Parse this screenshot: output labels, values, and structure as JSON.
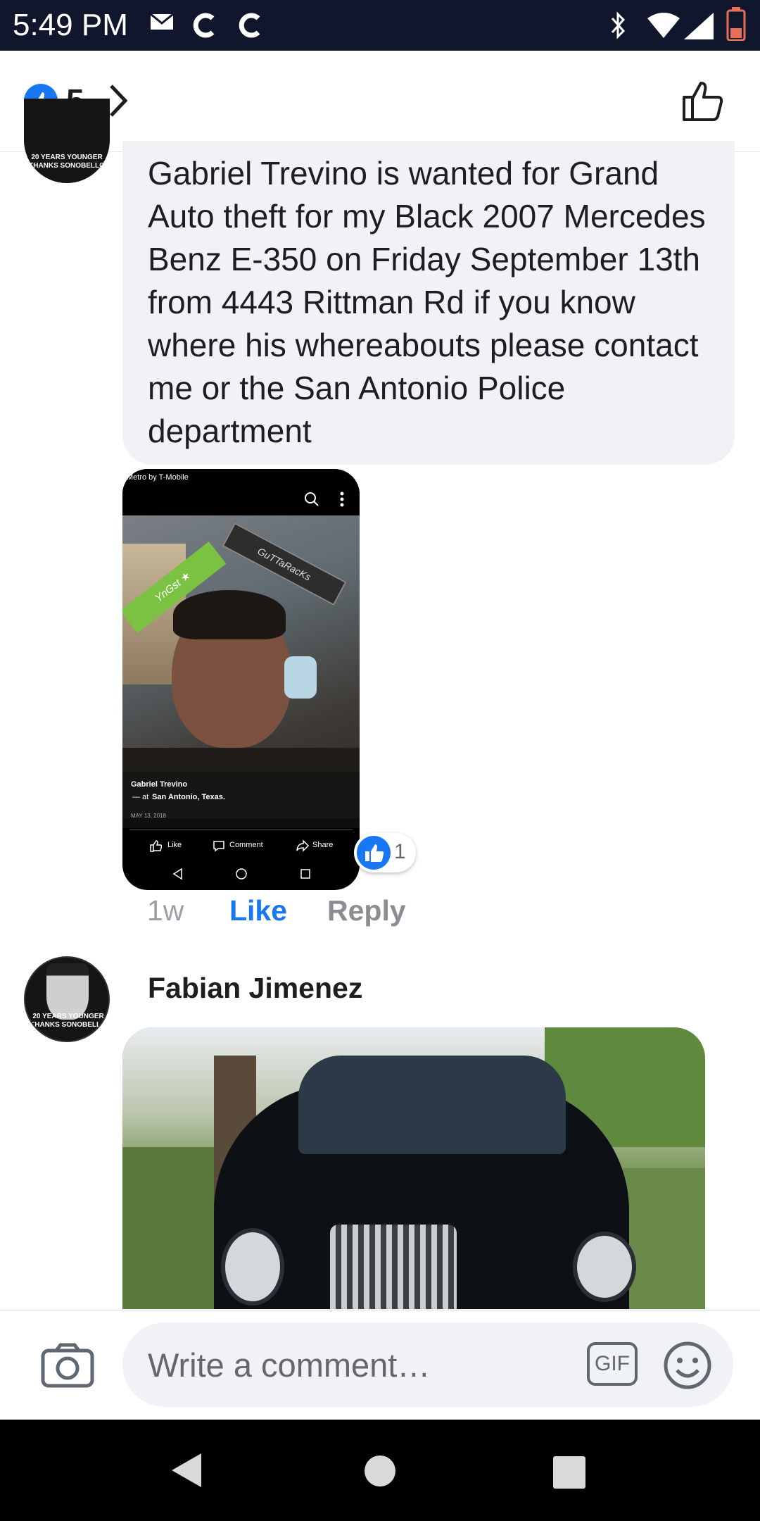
{
  "status_bar": {
    "time": "5:49 PM"
  },
  "reactions": {
    "count": "5"
  },
  "comments": [
    {
      "text": "Gabriel Trevino is wanted for Grand Auto theft for my Black 2007 Mercedes Benz E-350 on Friday September 13th from 4443 Rittman Rd if you know where his whereabouts please contact me or the San Antonio Police department",
      "avatar_caption": [
        "20 YEARS YOUNGER",
        "THANKS SONOBELLO"
      ],
      "attachment": {
        "status_carrier": "Metro by T-Mobile",
        "sticker_left": "YnGst ★",
        "sticker_right": "GuTTaRacKs",
        "profile_name": "Gabriel Trevino",
        "location_prefix": "— at",
        "location": "San Antonio, Texas.",
        "date": "MAY 13, 2018",
        "actions": [
          "Like",
          "Comment",
          "Share"
        ]
      },
      "like_count": "1",
      "time": "1w",
      "like_label": "Like",
      "reply_label": "Reply"
    },
    {
      "author": "Fabian Jimenez",
      "avatar_caption": [
        "20 YEARS YOUNGER",
        "THANKS SONOBELLO"
      ]
    }
  ],
  "composer": {
    "placeholder": "Write a comment…",
    "gif_label": "GIF"
  },
  "colors": {
    "accent": "#1877f2",
    "bubble": "#f0f2f5",
    "status_bar": "#10162b"
  }
}
